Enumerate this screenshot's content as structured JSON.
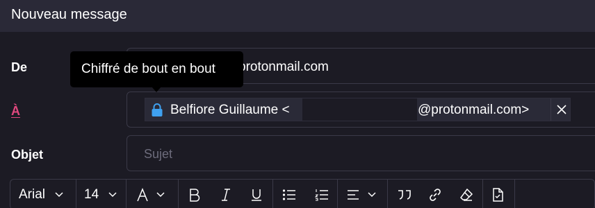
{
  "window": {
    "title": "Nouveau message"
  },
  "from": {
    "label": "De",
    "value": "protonmail.com"
  },
  "tooltip": {
    "text": "Chiffré de bout en bout"
  },
  "to": {
    "label": "À",
    "recipient": {
      "name": "Belfiore Guillaume <",
      "domain": "@protonmail.com>",
      "lock_icon": "lock-icon",
      "lock_color": "#3fa1f0"
    }
  },
  "subject": {
    "label": "Objet",
    "placeholder": "Sujet"
  },
  "toolbar": {
    "font": "Arial",
    "size": "14",
    "buttons": [
      "font-color",
      "bold",
      "italic",
      "underline",
      "bullet-list",
      "numbered-list",
      "align",
      "quote",
      "link",
      "clear-formatting",
      "insert-file"
    ]
  },
  "colors": {
    "accent": "#e2487f",
    "background": "#1c1b24",
    "header": "#2a2937"
  }
}
